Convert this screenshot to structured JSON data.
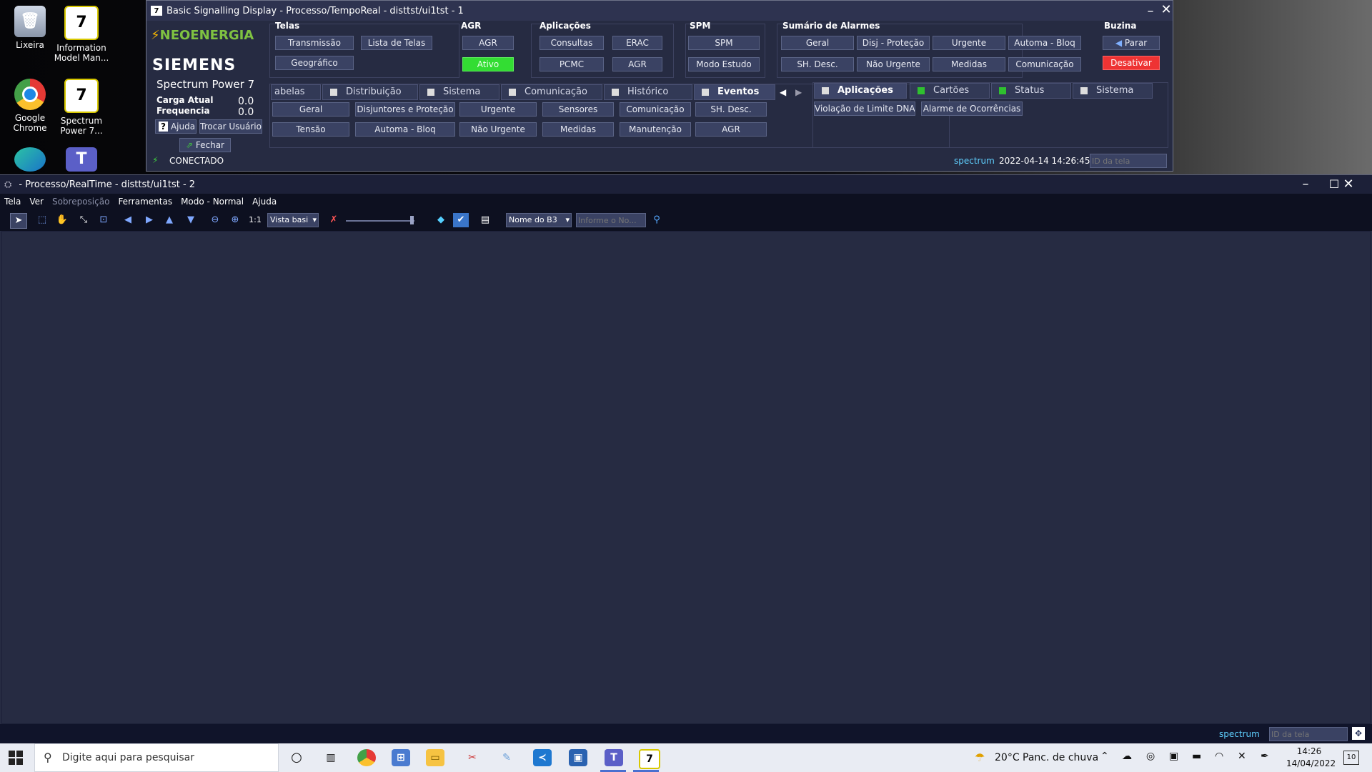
{
  "desktop": {
    "icons": [
      {
        "label": "Lixeira",
        "icon": "recycle-bin-icon"
      },
      {
        "label": "Information Model Man...",
        "icon": "app-7-icon"
      },
      {
        "label": "Google Chrome",
        "icon": "chrome-icon"
      },
      {
        "label": "Spectrum Power 7...",
        "icon": "app-7-icon"
      }
    ]
  },
  "bsd": {
    "title": "Basic Signalling Display - Processo/TempoReal - disttst/ui1tst - 1",
    "brand": {
      "company": "NEOENERGIA",
      "vendor": "SIEMENS",
      "product": "Spectrum Power 7"
    },
    "carga_label": "Carga Atual",
    "carga_value": "0.0",
    "freq_label": "Frequencia",
    "freq_value": "0.0",
    "ajuda": "Ajuda",
    "trocar": "Trocar Usuário",
    "fechar": "Fechar",
    "conectado": "CONECTADO",
    "telas": {
      "title": "Telas",
      "buttons": [
        "Transmissão",
        "Lista de Telas",
        "Geográfico"
      ]
    },
    "agr": {
      "title": "AGR",
      "button": "AGR",
      "status": "Ativo"
    },
    "aplicacoes": {
      "title": "Aplicações",
      "buttons": [
        "Consultas",
        "ERAC",
        "PCMC",
        "AGR"
      ]
    },
    "spm": {
      "title": "SPM",
      "buttons": [
        "SPM",
        "Modo Estudo"
      ]
    },
    "alarmes": {
      "title": "Sumário de Alarmes",
      "buttons": [
        "Geral",
        "Disj - Proteção",
        "Urgente",
        "Automa - Bloq",
        "SH. Desc.",
        "Não Urgente",
        "Medidas",
        "Comunicação"
      ]
    },
    "buzina": {
      "title": "Buzina",
      "parar": "Parar",
      "desativar": "Desativar"
    },
    "tabs_left": [
      "abelas",
      "Distribuição",
      "Sistema",
      "Comunicação",
      "Histórico",
      "Eventos"
    ],
    "event_buttons": [
      "Geral",
      "Disjuntores e Proteção",
      "Urgente",
      "Sensores",
      "Comunicação",
      "SH. Desc.",
      "Tensão",
      "Automa - Bloq",
      "Não Urgente",
      "Medidas",
      "Manutenção",
      "AGR"
    ],
    "tabs_right": [
      "Aplicações",
      "Cartões",
      "Status",
      "Sistema"
    ],
    "app_buttons": [
      "Violação de Limite DNA",
      "Alarme de Ocorrências"
    ],
    "footer": {
      "user": "spectrum",
      "datetime": "2022-04-14 14:26:45",
      "id_placeholder": "ID da tela"
    },
    "colors": {
      "ativo": "#33dd33",
      "desativar": "#ee3333",
      "accent_text": "#5fd0ff"
    }
  },
  "main": {
    "title": "- Processo/RealTime - disttst/ui1tst - 2",
    "menu": [
      "Tela",
      "Ver",
      "Sobreposição",
      "Ferramentas",
      "Modo - Normal",
      "Ajuda"
    ],
    "toolbar": {
      "zoom_ratio": "1:1",
      "view_select": "Vista basi",
      "name_select": "Nome do B3",
      "input_placeholder": "Informe o No..."
    },
    "footer": {
      "user": "spectrum",
      "id_placeholder": "ID da tela"
    }
  },
  "taskbar": {
    "search_placeholder": "Digite aqui para pesquisar",
    "weather": "20°C  Panc. de chuva",
    "time": "14:26",
    "date": "14/04/2022",
    "notif_count": "10"
  }
}
